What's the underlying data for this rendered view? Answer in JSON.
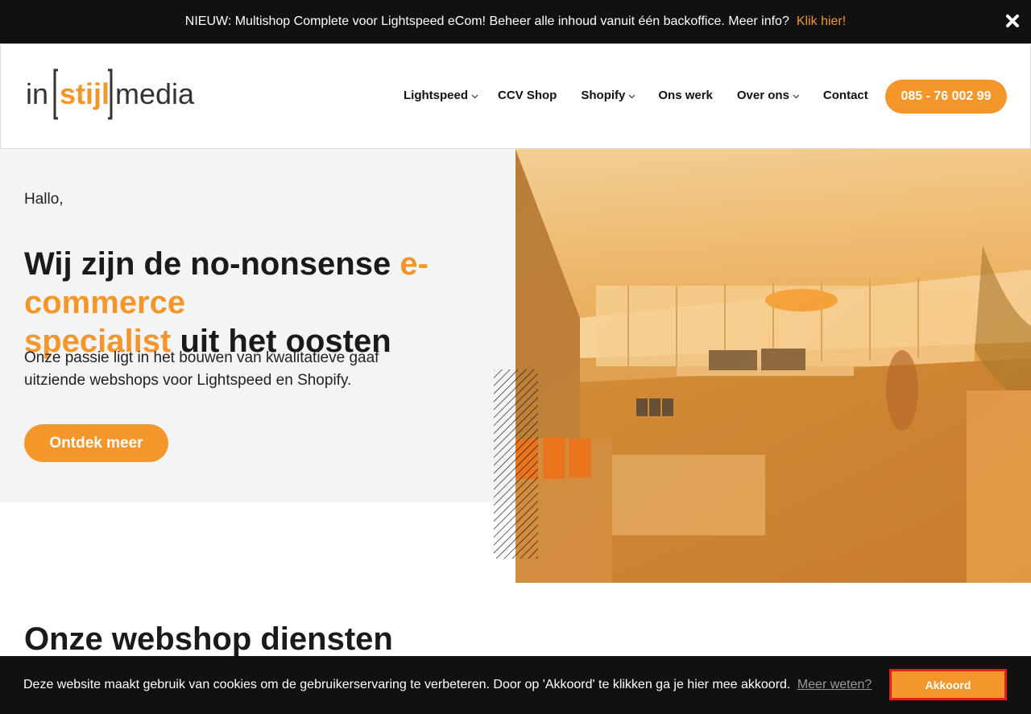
{
  "announcement": {
    "message": "NIEUW: Multishop Complete voor Lightspeed eCom! Beheer alle inhoud vanuit één backoffice. Meer info?",
    "link": "Klik hier!",
    "close_icon": "close-icon"
  },
  "header": {
    "logo": {
      "part1": "in",
      "part2": "stijl",
      "part3": "media"
    },
    "nav": [
      {
        "label": "Lightspeed",
        "dropdown": true
      },
      {
        "label": "CCV Shop",
        "dropdown": false
      },
      {
        "label": "Shopify",
        "dropdown": true
      },
      {
        "label": "Ons werk",
        "dropdown": false
      },
      {
        "label": "Over ons",
        "dropdown": true
      },
      {
        "label": "Contact",
        "dropdown": false
      }
    ],
    "phone": "085 - 76 002 99"
  },
  "hero": {
    "greeting": "Hallo,",
    "headline_part1": "Wij zijn de no-nonsense ",
    "headline_accent1": "e-commerce",
    "headline_accent2": "specialist",
    "headline_part2": " uit het oosten",
    "intro": "Onze passie ligt in het bouwen van kwalitatieve gaaf uitziende webshops voor Lightspeed en Shopify.",
    "cta": "Ontdek meer"
  },
  "services": {
    "title": "Onze webshop diensten"
  },
  "cookie": {
    "text": "Deze website maakt gebruik van cookies om de gebruikerservaring te verbeteren. Door op 'Akkoord' te klikken ga je hier mee akkoord.",
    "more": "Meer weten?",
    "accept": "Akkoord"
  },
  "colors": {
    "accent": "#f5962a",
    "dark": "#111111",
    "hero_bg": "#f3f4f5"
  }
}
